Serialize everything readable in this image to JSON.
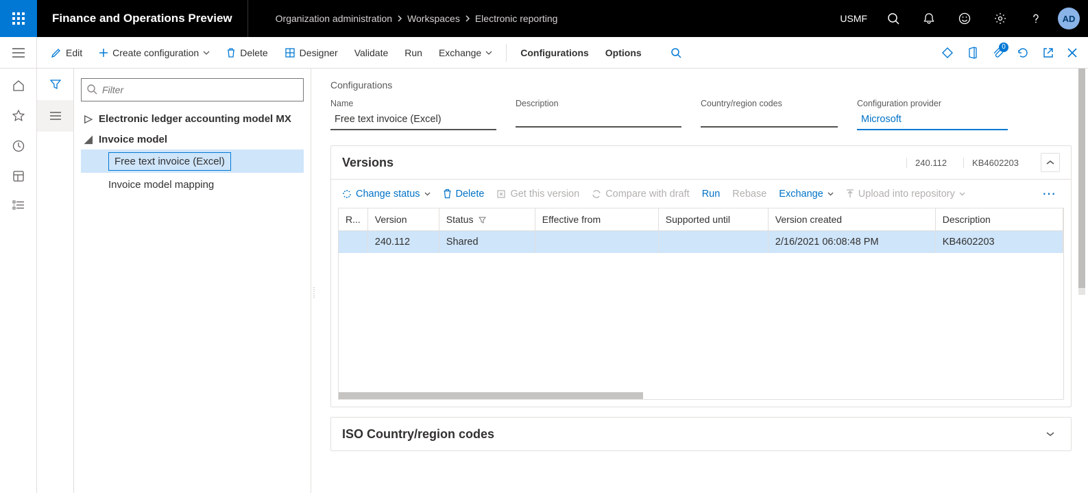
{
  "brand": "Finance and Operations Preview",
  "breadcrumbs": [
    "Organization administration",
    "Workspaces",
    "Electronic reporting"
  ],
  "company": "USMF",
  "avatar": "AD",
  "cmdbar": {
    "edit": "Edit",
    "create": "Create configuration",
    "delete": "Delete",
    "designer": "Designer",
    "validate": "Validate",
    "run": "Run",
    "exchange": "Exchange",
    "configurations": "Configurations",
    "options": "Options",
    "badge": "0"
  },
  "tree": {
    "filter_placeholder": "Filter",
    "root1": "Electronic ledger accounting model MX",
    "root2": "Invoice model",
    "children": [
      "Free text invoice (Excel)",
      "Invoice model mapping"
    ]
  },
  "page": {
    "label": "Configurations",
    "fields": {
      "name_label": "Name",
      "name_value": "Free text invoice (Excel)",
      "description_label": "Description",
      "description_value": "",
      "country_label": "Country/region codes",
      "country_value": "",
      "provider_label": "Configuration provider",
      "provider_value": "Microsoft"
    }
  },
  "versions": {
    "title": "Versions",
    "hdr_version": "240.112",
    "hdr_kb": "KB4602203",
    "toolbar": {
      "change_status": "Change status",
      "delete": "Delete",
      "get_version": "Get this version",
      "compare": "Compare with draft",
      "run": "Run",
      "rebase": "Rebase",
      "exchange": "Exchange",
      "upload": "Upload into repository"
    },
    "columns": {
      "r": "R...",
      "version": "Version",
      "status": "Status",
      "effective_from": "Effective from",
      "supported_until": "Supported until",
      "version_created": "Version created",
      "description": "Description"
    },
    "rows": [
      {
        "version": "240.112",
        "status": "Shared",
        "effective_from": "",
        "supported_until": "",
        "version_created": "2/16/2021 06:08:48 PM",
        "description": "KB4602203"
      }
    ]
  },
  "iso_panel": {
    "title": "ISO Country/region codes"
  }
}
